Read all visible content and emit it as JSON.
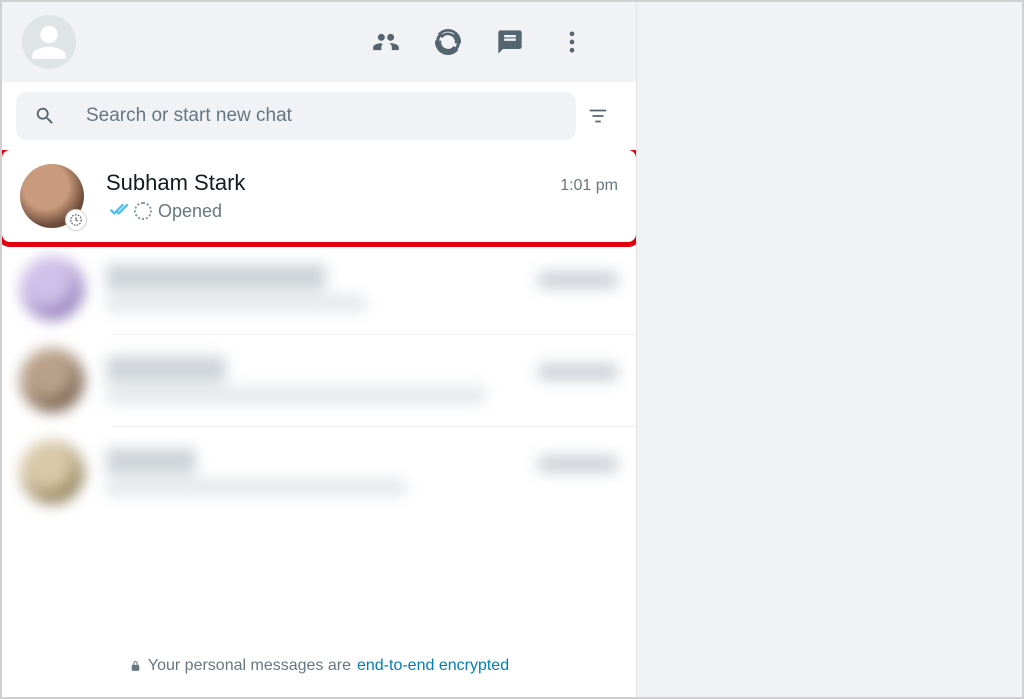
{
  "search": {
    "placeholder": "Search or start new chat"
  },
  "chats": [
    {
      "name": "Subham Stark",
      "time": "1:01 pm",
      "status_text": "Opened",
      "highlighted": true
    }
  ],
  "footer": {
    "prefix": "Your personal messages are ",
    "link": "end-to-end encrypted"
  }
}
